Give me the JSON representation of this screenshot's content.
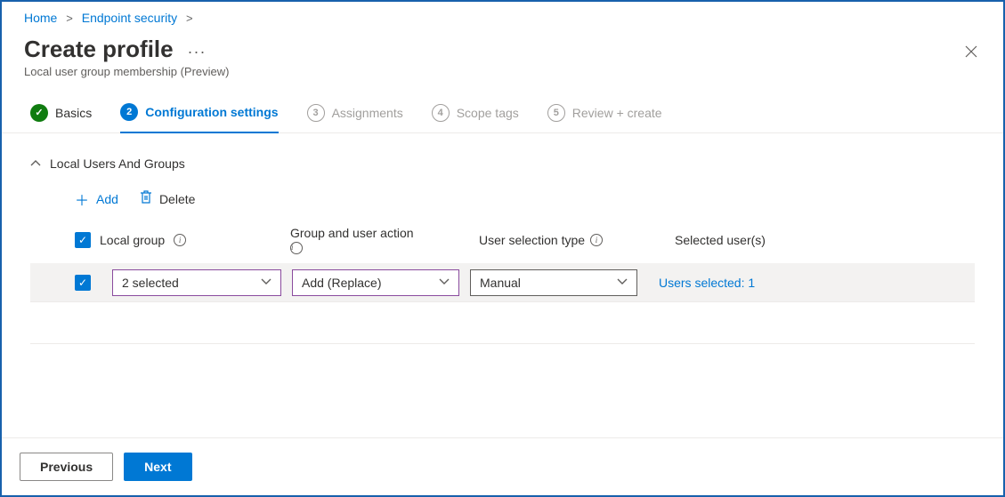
{
  "breadcrumb": {
    "home": "Home",
    "endpoint": "Endpoint security"
  },
  "header": {
    "title": "Create profile",
    "ellipsis": "···",
    "subtitle": "Local user group membership (Preview)"
  },
  "wizard": {
    "s1": {
      "label": "Basics"
    },
    "s2": {
      "num": "2",
      "label": "Configuration settings"
    },
    "s3": {
      "num": "3",
      "label": "Assignments"
    },
    "s4": {
      "num": "4",
      "label": "Scope tags"
    },
    "s5": {
      "num": "5",
      "label": "Review + create"
    }
  },
  "section": {
    "title": "Local Users And Groups"
  },
  "toolbar": {
    "add": "Add",
    "delete": "Delete"
  },
  "columns": {
    "localgroup": "Local group",
    "action": "Group and user action",
    "usertype": "User selection type",
    "selected": "Selected user(s)"
  },
  "row": {
    "localgroup": "2 selected",
    "action": "Add (Replace)",
    "usertype": "Manual",
    "selected": "Users selected: 1"
  },
  "footer": {
    "previous": "Previous",
    "next": "Next"
  }
}
